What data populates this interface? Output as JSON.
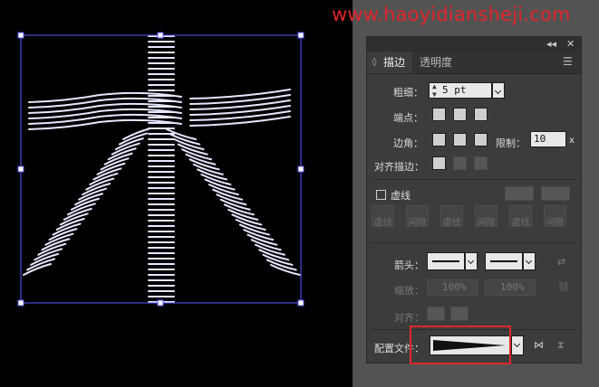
{
  "watermark": "www.haoyidiansheji.com",
  "panel": {
    "tabs": [
      {
        "label": "描边",
        "active": true
      },
      {
        "label": "透明度",
        "active": false
      }
    ],
    "weight": {
      "label": "粗细：",
      "value": "5 pt"
    },
    "cap": {
      "label": "端点："
    },
    "corner": {
      "label": "边角：",
      "limit_label": "限制：",
      "limit_value": "10",
      "limit_unit": "x"
    },
    "align": {
      "label": "对齐描边："
    },
    "dashed": {
      "label": "虚线",
      "checked": false
    },
    "dash_fields": [
      "虚线",
      "间隙",
      "虚线",
      "间隙",
      "虚线",
      "间隙"
    ],
    "arrow": {
      "label": "箭头："
    },
    "scale": {
      "label": "缩放：",
      "start": "100%",
      "end": "100%"
    },
    "arrow_align": {
      "label": "对齐："
    },
    "profile": {
      "label": "配置文件："
    }
  },
  "colors": {
    "canvas": "#000000",
    "workspace": "#535353",
    "panel": "#3c3c3c",
    "selection": "#5a5aff",
    "highlight": "#e0262c"
  }
}
